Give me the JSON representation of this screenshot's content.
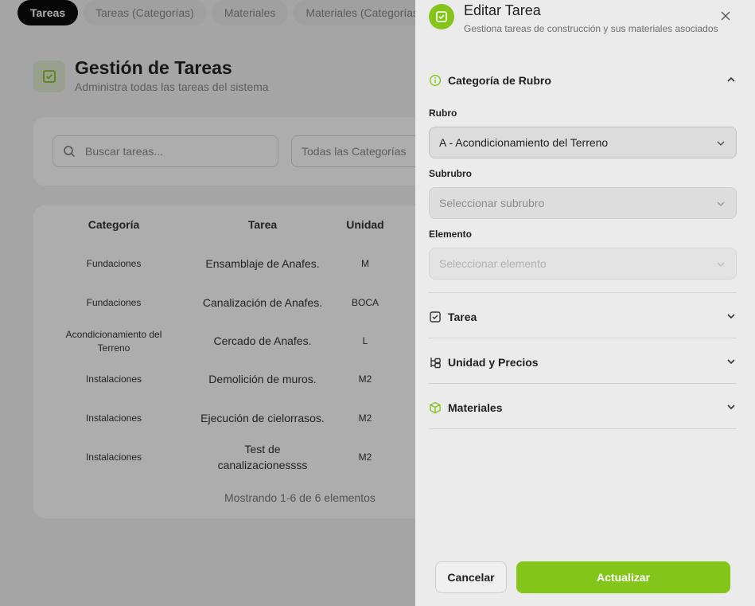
{
  "tabs": [
    {
      "label": "Tareas",
      "active": true
    },
    {
      "label": "Tareas (Categorías)",
      "active": false
    },
    {
      "label": "Materiales",
      "active": false
    },
    {
      "label": "Materiales (Categorías)",
      "active": false
    }
  ],
  "page": {
    "title": "Gestión de Tareas",
    "subtitle": "Administra todas las tareas del sistema"
  },
  "filters": {
    "search_placeholder": "Buscar tareas...",
    "category_value": "Todas las Categorías"
  },
  "table": {
    "headers": {
      "category": "Categoría",
      "task": "Tarea",
      "unit": "Unidad"
    },
    "rows": [
      {
        "category": "Fundaciones",
        "task": "Ensamblaje de Anafes.",
        "unit": "M"
      },
      {
        "category": "Fundaciones",
        "task": "Canalización de Anafes.",
        "unit": "BOCA"
      },
      {
        "category": "Acondicionamiento del Terreno",
        "task": "Cercado de Anafes.",
        "unit": "L"
      },
      {
        "category": "Instalaciones",
        "task": "Demolición de muros.",
        "unit": "M2"
      },
      {
        "category": "Instalaciones",
        "task": "Ejecución de cielorrasos.",
        "unit": "M2"
      },
      {
        "category": "Instalaciones",
        "task": "Test de canalizacionessss",
        "unit": "M2"
      }
    ],
    "footer": "Mostrando 1-6 de 6 elementos"
  },
  "drawer": {
    "title": "Editar Tarea",
    "subtitle": "Gestiona tareas de construcción y sus materiales asociados",
    "sections": {
      "category": {
        "label": "Categoría de Rubro",
        "expanded": true
      },
      "task": {
        "label": "Tarea",
        "expanded": false
      },
      "unit_prices": {
        "label": "Unidad y Precios",
        "expanded": false
      },
      "materials": {
        "label": "Materiales",
        "expanded": false
      }
    },
    "fields": {
      "rubro": {
        "label": "Rubro",
        "value": "A - Acondicionamiento del Terreno"
      },
      "subrubro": {
        "label": "Subrubro",
        "placeholder": "Seleccionar subrubro"
      },
      "elemento": {
        "label": "Elemento",
        "placeholder": "Seleccionar elemento"
      }
    },
    "buttons": {
      "cancel": "Cancelar",
      "update": "Actualizar"
    }
  },
  "colors": {
    "accent": "#84c51a",
    "tab_active_bg": "#0b0b0b",
    "drawer_bg": "#ebebeb"
  }
}
